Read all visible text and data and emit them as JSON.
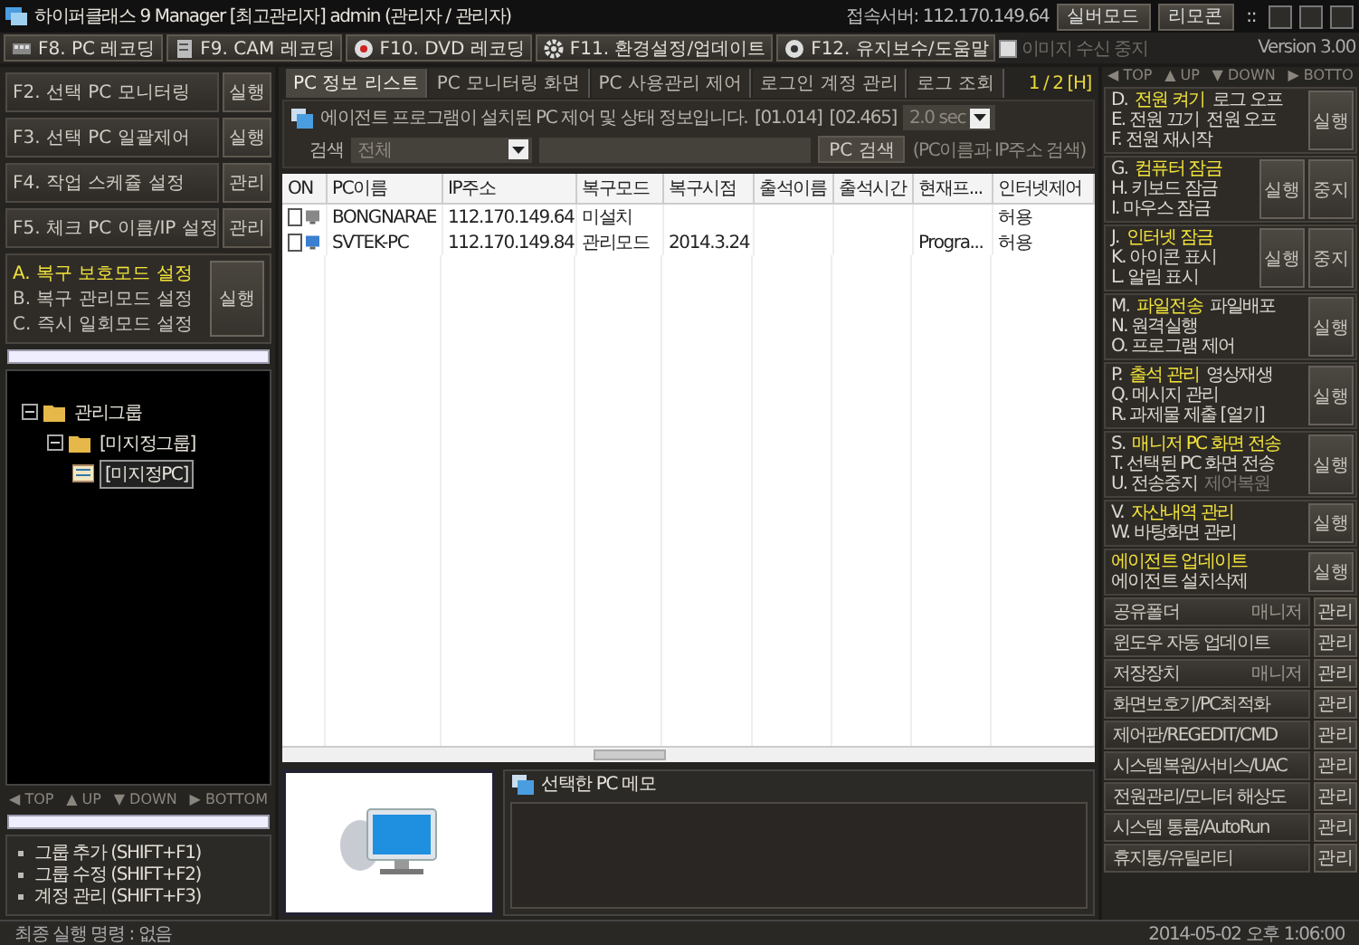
{
  "window": {
    "title": "하이퍼클래스 9 Manager [최고관리자] admin (관리자 / 관리자)",
    "server": "접속서버: 112.170.149.64",
    "buttons": [
      "실버모드",
      "리모콘"
    ],
    "grip": "::"
  },
  "toolbar": {
    "buttons": [
      "F8. PC 레코딩",
      "F9. CAM 레코딩",
      "F10. DVD 레코딩",
      "F11. 환경설정/업데이트",
      "F12. 유지보수/도움말"
    ],
    "image_stop": {
      "label": "이미지 수신 중지",
      "checked": false,
      "disabled": true
    },
    "version": "Version 3.00"
  },
  "left": {
    "actions": [
      {
        "label": "F2. 선택 PC 모니터링",
        "button": "실행"
      },
      {
        "label": "F3. 선택 PC 일괄제어",
        "button": "실행"
      },
      {
        "label": "F4. 작업 스케쥴 설정",
        "button": "관리"
      },
      {
        "label": "F5. 체크 PC 이름/IP 설정",
        "button": "관리"
      }
    ],
    "recovery": {
      "options": [
        {
          "label": "A. 복구 보호모드 설정",
          "selected": true
        },
        {
          "label": "B. 복구 관리모드 설정",
          "selected": false
        },
        {
          "label": "C. 즉시 일회모드 설정",
          "selected": false
        }
      ],
      "button": "실행"
    },
    "tree": [
      {
        "label": "관리그룹",
        "expanded": true,
        "selected": false,
        "children": [
          {
            "label": "[미지정그룹]",
            "expanded": true,
            "selected": false,
            "children": [
              {
                "label": "[미지정PC]",
                "selected": true
              }
            ]
          }
        ]
      }
    ],
    "nav": [
      "◀ TOP",
      "▲ UP",
      "▼ DOWN",
      "▶ BOTTOM"
    ],
    "group_menu": [
      "그룹 추가 (SHIFT+F1)",
      "그룹 수정 (SHIFT+F2)",
      "계정 관리 (SHIFT+F3)"
    ]
  },
  "center": {
    "tabs": [
      {
        "label": "PC 정보 리스트",
        "selected": true
      },
      {
        "label": "PC 모니터링 화면",
        "selected": false
      },
      {
        "label": "PC 사용관리 제어",
        "selected": false
      },
      {
        "label": "로그인 계정 관리",
        "selected": false
      },
      {
        "label": "로그 조회",
        "selected": false
      }
    ],
    "page": "1 / 2 [H]",
    "info": {
      "text": "에이전트 프로그램이 설치된 PC 제어 및 상태 정보입니다.",
      "codes": [
        "[01.014]",
        "[02.465]"
      ],
      "interval": "2.0 sec"
    },
    "search": {
      "label": "검색",
      "scope": "전체",
      "button": "PC 검색",
      "hint": "(PC이름과 IP주소 검색)"
    },
    "table": {
      "columns": [
        "ON",
        "PC이름",
        "IP주소",
        "복구모드",
        "복구시점",
        "출석이름",
        "출석시간",
        "현재프...",
        "인터넷제어"
      ],
      "rows": [
        {
          "checked": false,
          "online": false,
          "cells": [
            "",
            "BONGNARAE",
            "112.170.149.64",
            "미설치",
            "",
            "",
            "",
            "",
            "허용"
          ]
        },
        {
          "checked": false,
          "online": true,
          "cells": [
            "",
            "SVTEK-PC",
            "112.170.149.84",
            "관리모드",
            "2014.3.24",
            "",
            "",
            "Progra...",
            "허용"
          ]
        }
      ]
    },
    "memo": {
      "title": "선택한 PC 메모"
    }
  },
  "right": {
    "nav": [
      "◀ TOP",
      "▲ UP",
      "▼ DOWN",
      "▶ BOTTO"
    ],
    "groups": [
      {
        "lines": [
          [
            {
              "text": "D.",
              "kind": "plain"
            },
            {
              "text": "전원 켜기",
              "kind": "highlight"
            },
            {
              "text": "로그 오프",
              "kind": "plain"
            }
          ],
          [
            {
              "text": "E. 전원 끄기",
              "kind": "plain"
            },
            {
              "text": "전원 오프",
              "kind": "plain"
            }
          ],
          [
            {
              "text": "F. 전원 재시작",
              "kind": "plain"
            }
          ]
        ],
        "buttons": [
          "실행"
        ]
      },
      {
        "lines": [
          [
            {
              "text": "G.",
              "kind": "plain"
            },
            {
              "text": "컴퓨터 잠금",
              "kind": "highlight"
            }
          ],
          [
            {
              "text": "H. 키보드 잠금",
              "kind": "plain"
            }
          ],
          [
            {
              "text": "I. 마우스 잠금",
              "kind": "plain"
            }
          ]
        ],
        "buttons": [
          "실행",
          "중지"
        ]
      },
      {
        "lines": [
          [
            {
              "text": "J.",
              "kind": "plain"
            },
            {
              "text": "인터넷 잠금",
              "kind": "highlight"
            }
          ],
          [
            {
              "text": "K. 아이콘 표시",
              "kind": "plain"
            }
          ],
          [
            {
              "text": "L. 알림 표시",
              "kind": "plain"
            }
          ]
        ],
        "buttons": [
          "실행",
          "중지"
        ]
      },
      {
        "lines": [
          [
            {
              "text": "M.",
              "kind": "plain"
            },
            {
              "text": "파일전송",
              "kind": "highlight"
            },
            {
              "text": "파일배포",
              "kind": "plain"
            }
          ],
          [
            {
              "text": "N. 원격실행",
              "kind": "plain"
            }
          ],
          [
            {
              "text": "O. 프로그램 제어",
              "kind": "plain"
            }
          ]
        ],
        "buttons": [
          "실행"
        ]
      },
      {
        "lines": [
          [
            {
              "text": "P.",
              "kind": "plain"
            },
            {
              "text": "출석 관리",
              "kind": "highlight"
            },
            {
              "text": "영상재생",
              "kind": "plain"
            }
          ],
          [
            {
              "text": "Q. 메시지 관리",
              "kind": "plain"
            }
          ],
          [
            {
              "text": "R. 과제물 제출 [열기]",
              "kind": "plain"
            }
          ]
        ],
        "buttons": [
          "실행"
        ]
      },
      {
        "lines": [
          [
            {
              "text": "S.",
              "kind": "plain"
            },
            {
              "text": "매니저 PC 화면 전송",
              "kind": "highlight"
            }
          ],
          [
            {
              "text": "T. 선택된 PC 화면 전송",
              "kind": "plain"
            }
          ],
          [
            {
              "text": "U. 전송중지",
              "kind": "plain"
            },
            {
              "text": "제어복원",
              "kind": "muted"
            }
          ]
        ],
        "buttons": [
          "실행"
        ]
      },
      {
        "lines": [
          [
            {
              "text": "V.",
              "kind": "plain"
            },
            {
              "text": "자산내역 관리",
              "kind": "highlight"
            }
          ],
          [
            {
              "text": "W. 바탕화면 관리",
              "kind": "plain"
            }
          ]
        ],
        "buttons": [
          "실행"
        ]
      },
      {
        "lines": [
          [
            {
              "text": "에이전트 업데이트",
              "kind": "highlight"
            }
          ],
          [
            {
              "text": "에이전트 설치삭제",
              "kind": "plain"
            }
          ]
        ],
        "buttons": [
          "실행"
        ]
      }
    ],
    "tools": [
      {
        "label": "공유폴더",
        "extra": "매니저",
        "button": "관리"
      },
      {
        "label": "윈도우 자동 업데이트",
        "button": "관리"
      },
      {
        "label": "저장장치",
        "extra": "매니저",
        "button": "관리"
      },
      {
        "label": "화면보호기/PC최적화",
        "button": "관리"
      },
      {
        "label": "제어판/REGEDIT/CMD",
        "button": "관리"
      },
      {
        "label": "시스템복원/서비스/UAC",
        "button": "관리"
      },
      {
        "label": "전원관리/모니터 해상도",
        "button": "관리"
      },
      {
        "label": "시스템 통륨/AutoRun",
        "button": "관리"
      },
      {
        "label": "휴지통/유틸리티",
        "button": "관리"
      }
    ]
  },
  "status_bar": {
    "last_command": "최종 실행 명령 : 없음",
    "datetime": "2014-05-02 오후 1:06:00"
  }
}
